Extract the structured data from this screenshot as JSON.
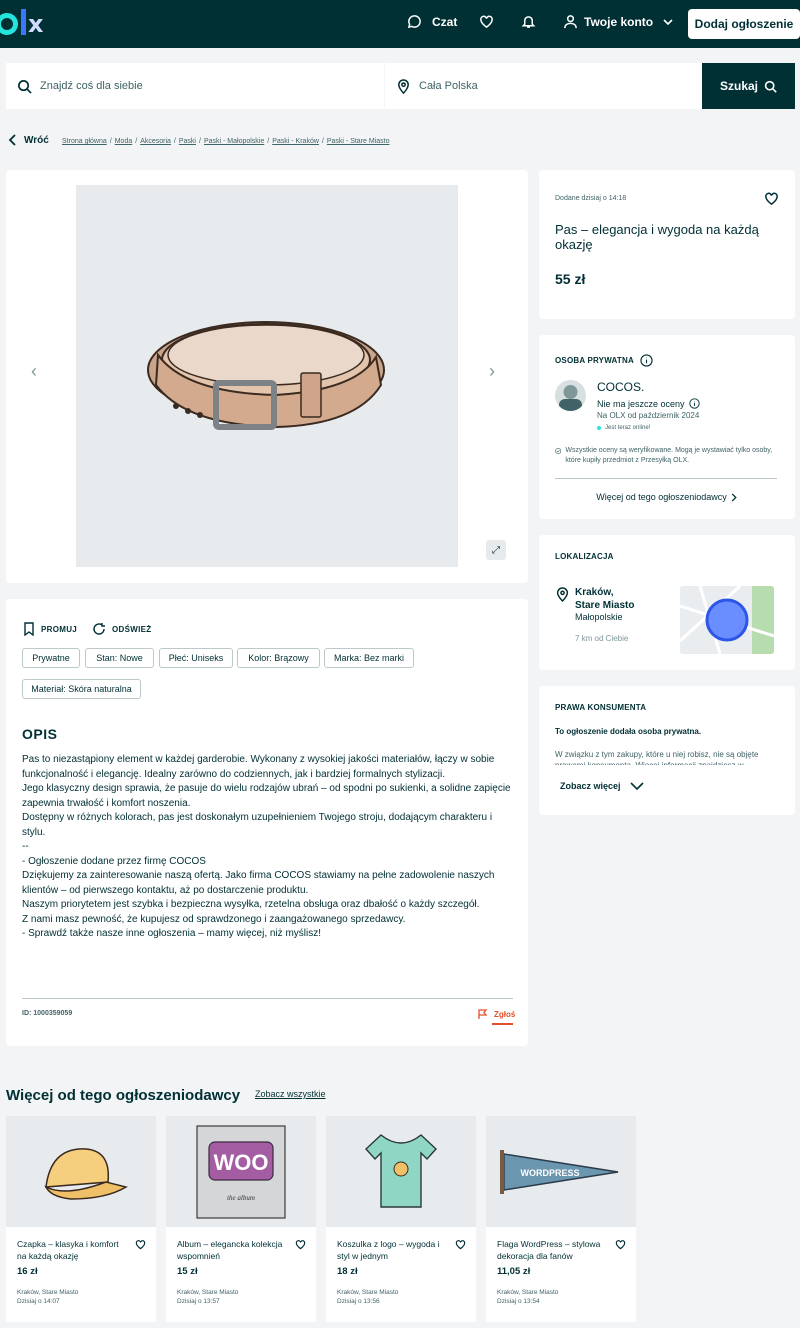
{
  "header": {
    "logo_text": "olx",
    "chat_label": "Czat",
    "account_label": "Twoje konto",
    "post_button": "Dodaj ogłoszenie"
  },
  "search": {
    "placeholder": "Znajdź coś dla siebie",
    "location": "Cała Polska",
    "button": "Szukaj"
  },
  "breadcrumb": {
    "back": "Wróć",
    "items": [
      "Strona główna",
      "Moda",
      "Akcesoria",
      "Paski",
      "Paski - Małopolskie",
      "Paski - Kraków",
      "Paski - Stare Miasto"
    ]
  },
  "listing": {
    "date": "Dodane dzisiaj o 14:18",
    "title": "Pas – elegancja i wygoda na każdą okazję",
    "price": "55 zł",
    "promote": "PROMUJ",
    "refresh": "ODŚWIEŻ",
    "tags": [
      "Prywatne",
      "Stan: Nowe",
      "Płeć: Uniseks",
      "Kolor: Brązowy",
      "Marka: Bez marki",
      "Materiał: Skóra naturalna"
    ],
    "desc_title": "OPIS",
    "description": [
      "Pas to niezastąpiony element w każdej garderobie. Wykonany z wysokiej jakości materiałów, łączy w sobie funkcjonalność i elegancję. Idealny zarówno do codziennych, jak i bardziej formalnych stylizacji.",
      "Jego klasyczny design sprawia, że pasuje do wielu rodzajów ubrań – od spodni po sukienki, a solidne zapięcie zapewnia trwałość i komfort noszenia.",
      "Dostępny w różnych kolorach, pas jest doskonałym uzupełnieniem Twojego stroju, dodającym charakteru i stylu.",
      "",
      "--",
      "- Ogłoszenie dodane przez firmę COCOS",
      "",
      "Dziękujemy za zainteresowanie naszą ofertą. Jako firma COCOS stawiamy na pełne zadowolenie naszych klientów – od pierwszego kontaktu, aż po dostarczenie produktu.",
      "Naszym priorytetem jest szybka i bezpieczna wysyłka, rzetelna obsługa oraz dbałość o każdy szczegół.",
      "Z nami masz pewność, że kupujesz od sprawdzonego i zaangażowanego sprzedawcy.",
      "",
      "- Sprawdź także nasze inne ogłoszenia – mamy więcej, niż myślisz!"
    ],
    "id": "ID: 1000359059",
    "report": "Zgłoś"
  },
  "seller": {
    "heading": "OSOBA PRYWATNA",
    "name": "COCOS.",
    "rating": "Nie ma jeszcze oceny",
    "since": "Na OLX od październik 2024",
    "online": "Jest teraz online!",
    "verified": "Wszystkie oceny są weryfikowane. Mogą je wystawiać tylko osoby, które kupiły przedmiot z Przesyłką OLX.",
    "more_link": "Więcej od tego ogłoszeniodawcy"
  },
  "location": {
    "heading": "LOKALIZACJA",
    "city": "Kraków,",
    "district": "Stare Miasto",
    "region": "Małopolskie",
    "distance": "7 km od Ciebie"
  },
  "consumer": {
    "heading": "PRAWA KONSUMENTA",
    "bold": "To ogłoszenie dodała osoba prywatna.",
    "text": "W związku z tym zakupy, które u niej robisz, nie są objęte prawami konsumenta. Więcej informacji znajdziesz w regulaminie.",
    "see_more": "Zobacz więcej"
  },
  "more": {
    "heading": "Więcej od tego ogłoszeniodawcy",
    "see_all": "Zobacz wszystkie",
    "items": [
      {
        "title": "Czapka – klasyka i komfort na każdą okazję",
        "price": "16 zł",
        "location": "Kraków, Stare Miasto",
        "date": "Dzisiaj o 14:07"
      },
      {
        "title": "Album – elegancka kolekcja wspomnień",
        "price": "15 zł",
        "location": "Kraków, Stare Miasto",
        "date": "Dzisiaj o 13:57"
      },
      {
        "title": "Koszulka z logo – wygoda i styl w jednym",
        "price": "18 zł",
        "location": "Kraków, Stare Miasto",
        "date": "Dzisiaj o 13:56"
      },
      {
        "title": "Flaga WordPress – stylowa dekoracja dla fanów",
        "price": "11,05 zł",
        "location": "Kraków, Stare Miasto",
        "date": "Dzisiaj o 13:54"
      }
    ]
  },
  "art": {
    "album_word": "WOO",
    "album_sub": "the album",
    "flag_word": "WORDPRESS"
  },
  "colors": {
    "brand_dark": "#002f34",
    "accent_teal": "#23e5db",
    "report_orange": "#e0512b"
  }
}
